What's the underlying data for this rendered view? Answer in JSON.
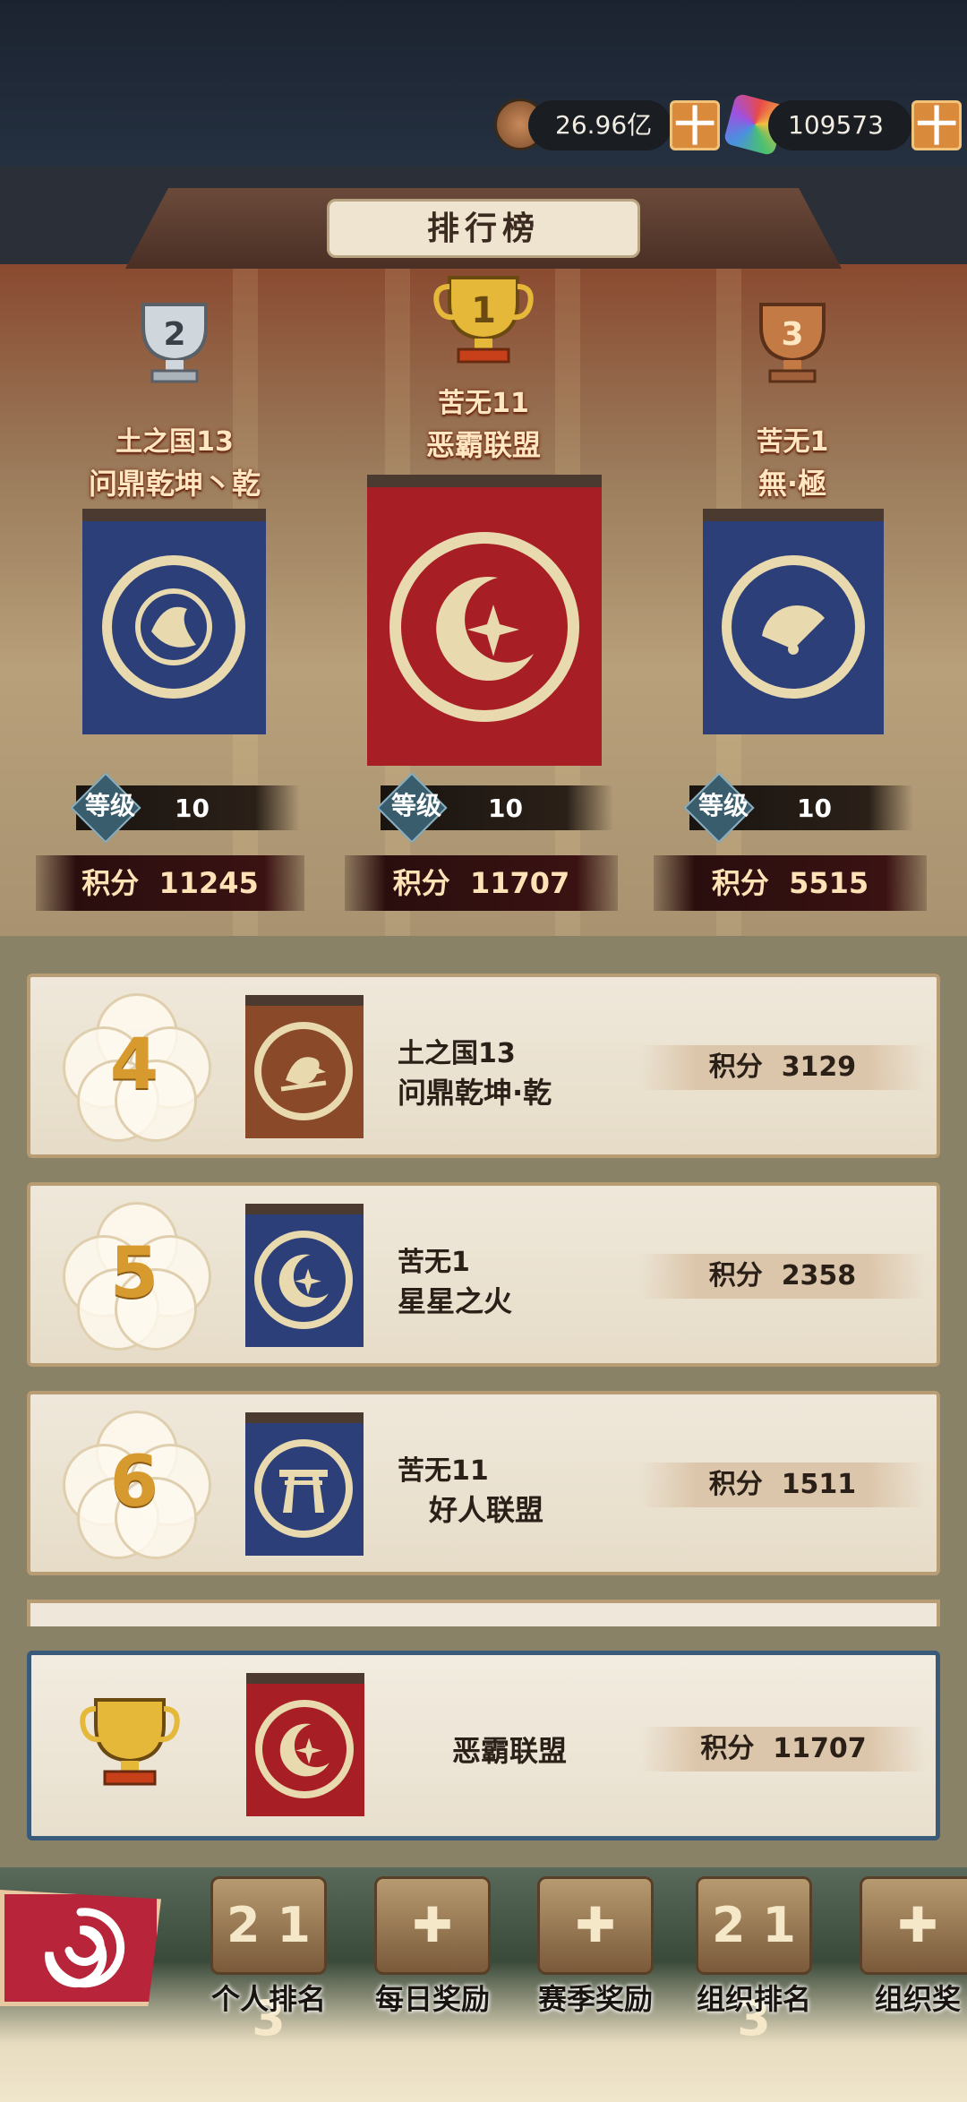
{
  "resources": {
    "coins": "26.96亿",
    "gems": "109573",
    "plus": "十"
  },
  "header": {
    "title": "排行榜"
  },
  "podium": [
    {
      "rank": "2",
      "trophy_color": "#cfd6dc",
      "org": "土之国13",
      "name": "问鼎乾坤丶乾",
      "banner": "blue",
      "emblem": "koi-icon",
      "level_label": "等级",
      "level": "10",
      "score_label": "积分",
      "score": "11245"
    },
    {
      "rank": "1",
      "trophy_color": "#e6b83a",
      "org": "苦无11",
      "name": "恶霸联盟",
      "banner": "red",
      "emblem": "crescent-star-icon",
      "level_label": "等级",
      "level": "10",
      "score_label": "积分",
      "score": "11707"
    },
    {
      "rank": "3",
      "trophy_color": "#c47a45",
      "org": "苦无1",
      "name": "無·極",
      "banner": "blue",
      "emblem": "fan-icon",
      "level_label": "等级",
      "level": "10",
      "score_label": "积分",
      "score": "5515"
    }
  ],
  "list": [
    {
      "rank": "4",
      "banner": "brown",
      "emblem": "bird-icon",
      "org": "土之国13",
      "name": "问鼎乾坤·乾",
      "score_label": "积分",
      "score": "3129"
    },
    {
      "rank": "5",
      "banner": "blue",
      "emblem": "crescent-star-icon",
      "org": "苦无1",
      "name": "星星之火",
      "score_label": "积分",
      "score": "2358"
    },
    {
      "rank": "6",
      "banner": "blue",
      "emblem": "torii-icon",
      "org": "苦无11",
      "name": "好人联盟",
      "score_label": "积分",
      "score": "1511"
    }
  ],
  "my_entry": {
    "name": "恶霸联盟",
    "score_label": "积分",
    "score": "11707"
  },
  "bottom_nav": [
    {
      "label": "个人排名",
      "icon": "podium-icon"
    },
    {
      "label": "每日奖励",
      "icon": "gift-box-icon"
    },
    {
      "label": "赛季奖励",
      "icon": "gift-box-icon"
    },
    {
      "label": "组织排名",
      "icon": "podium-icon"
    },
    {
      "label": "组织奖",
      "icon": "gift-box-icon"
    }
  ],
  "colors": {
    "banner_red": "#a81e25",
    "banner_blue": "#2d3f78",
    "banner_brown": "#8a4a2a",
    "accent_gold": "#d79a2e"
  }
}
